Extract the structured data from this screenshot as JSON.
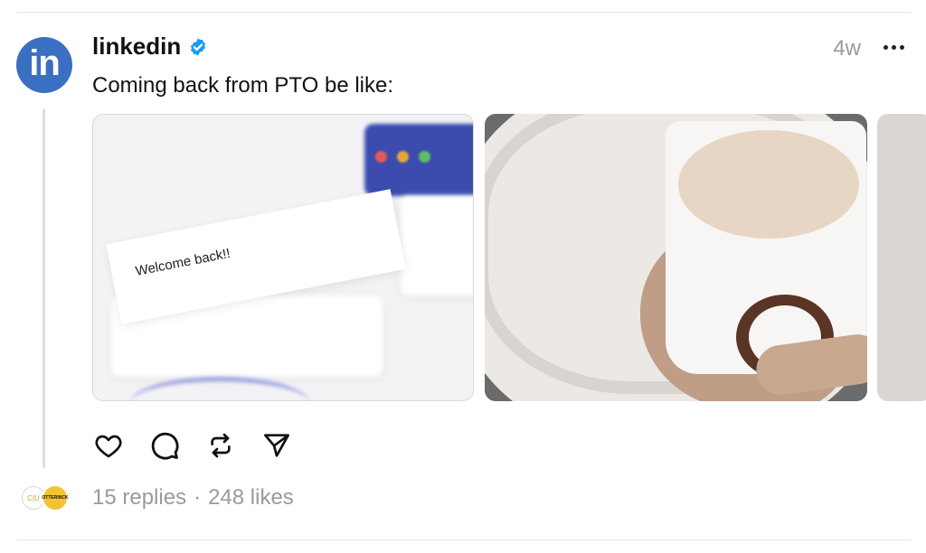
{
  "post": {
    "avatar_text": "in",
    "username": "linkedin",
    "verified_icon": "verified-badge-icon",
    "timestamp": "4w",
    "more_icon": "more-options-icon",
    "text": "Coming back from PTO be like:"
  },
  "media": {
    "image1": {
      "caption_text": "Welcome back!!"
    },
    "image2": {},
    "image3": {}
  },
  "actions": {
    "like_icon": "heart-icon",
    "comment_icon": "comment-icon",
    "repost_icon": "repost-icon",
    "share_icon": "send-icon"
  },
  "footer": {
    "replier1_text": "C|U",
    "replier2_text": "OTTERINCK",
    "replies": "15 replies",
    "separator": "·",
    "likes": "248 likes"
  },
  "colors": {
    "linkedin_blue": "#3b6fc2",
    "verified_blue": "#1d9bf0",
    "muted_text": "#9a9a9a"
  }
}
